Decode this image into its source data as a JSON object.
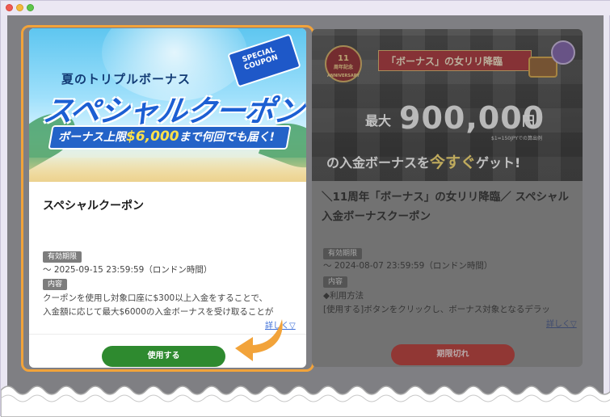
{
  "window": {
    "controls": [
      "close",
      "minimize",
      "zoom"
    ]
  },
  "coupons": [
    {
      "banner": {
        "headline": "夏のトリプルボーナス",
        "main": "スペシャルクーポン",
        "bar_text_pre": "ボーナス上限",
        "bar_amount": "$6,000",
        "bar_text_post": "まで何回でも届く!",
        "coupon_badge_line1": "SPECIAL",
        "coupon_badge_line2": "COUPON"
      },
      "title": "スペシャルクーポン",
      "expiry_label": "有効期限",
      "expiry_value": "～ 2025-09-15 23:59:59（ロンドン時間）",
      "content_label": "内容",
      "content_line1": "クーポンを使用し対象口座に$300以上入金をすることで、",
      "content_line2": "入金額に応じて最大$6000の入金ボーナスを受け取ることが",
      "more_link": "詳しく▽",
      "action_label": "使用する",
      "status_color": "#2e8a2f"
    },
    {
      "banner": {
        "badge_line1": "11",
        "badge_line2": "周年記念",
        "badge_line3": "ANNIVERSARY",
        "ribbon": "「ボーナス」の女リリ降臨",
        "max_label": "最大",
        "amount": "900,000",
        "yen": "円",
        "fine_print": "$1=150JPYでの算出例",
        "sub_pre": "の入金ボーナスを",
        "sub_em": "今すぐ",
        "sub_post": "ゲット!"
      },
      "title": "＼11周年「ボーナス」の女リリ降臨／ スペシャル入金ボーナスクーポン",
      "expiry_label": "有効期限",
      "expiry_value": "～ 2024-08-07 23:59:59（ロンドン時間）",
      "content_label": "内容",
      "content_line1": "◆利用方法",
      "content_line2": "[使用する]ボタンをクリックし、ボーナス対象となるデラッ",
      "more_link": "詳しく▽",
      "action_label": "期限切れ",
      "status_color": "#b82f2b"
    }
  ],
  "colors": {
    "highlight_outline": "#f2a33a",
    "annotation_arrow": "#f2a33a",
    "link": "#3d6fd8"
  }
}
